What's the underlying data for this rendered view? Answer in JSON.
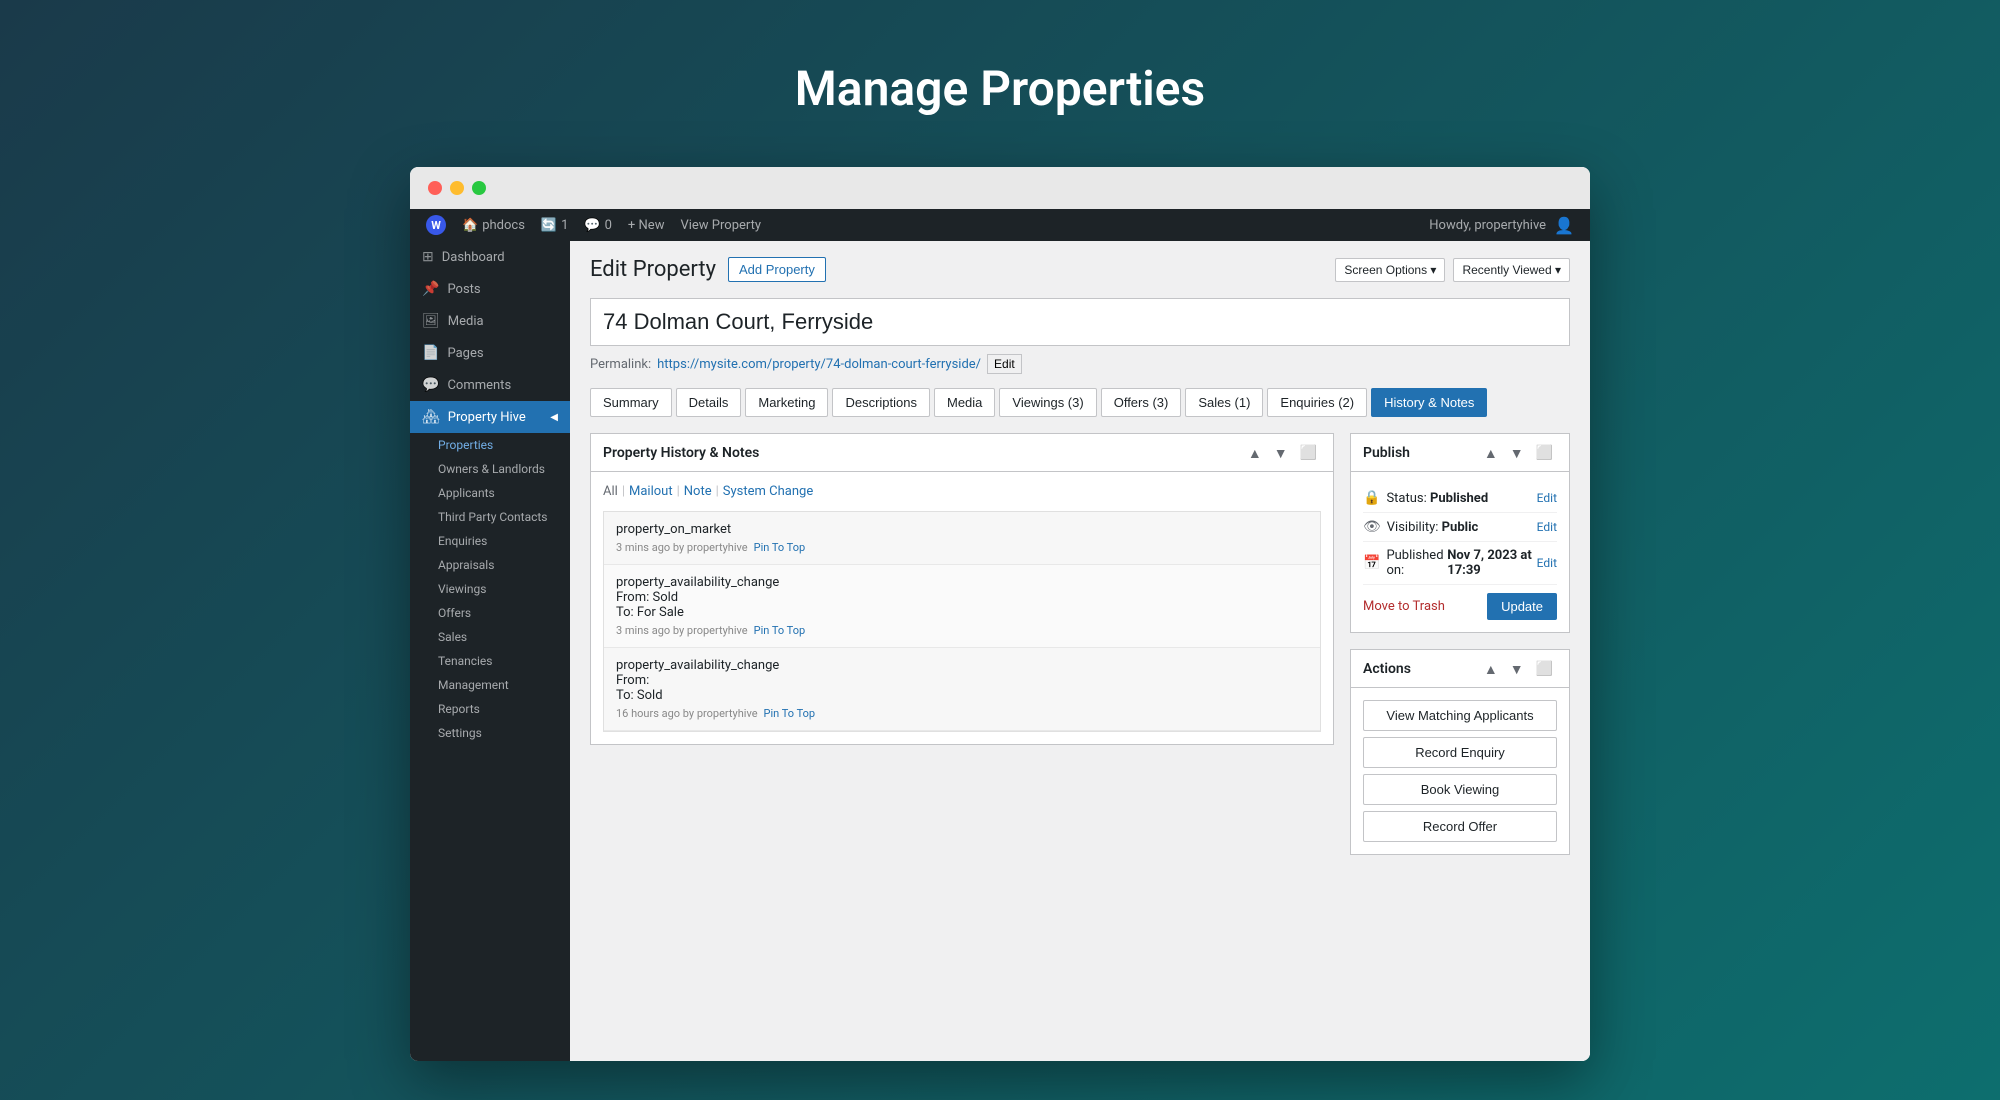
{
  "page": {
    "title": "Manage Properties"
  },
  "admin_bar": {
    "wp_label": "W",
    "site": "phdocs",
    "updates": "1",
    "comments": "0",
    "new_label": "+ New",
    "view_label": "View Property",
    "howdy": "Howdy, propertyhive"
  },
  "sidebar": {
    "dashboard": "Dashboard",
    "posts": "Posts",
    "media": "Media",
    "pages": "Pages",
    "comments": "Comments",
    "property_hive": "Property Hive",
    "properties": "Properties",
    "owners_landlords": "Owners & Landlords",
    "applicants": "Applicants",
    "third_party_contacts": "Third Party Contacts",
    "enquiries": "Enquiries",
    "appraisals": "Appraisals",
    "viewings": "Viewings",
    "offers": "Offers",
    "sales": "Sales",
    "tenancies": "Tenancies",
    "management": "Management",
    "reports": "Reports",
    "settings": "Settings"
  },
  "top_right": {
    "screen_options": "Screen Options ▾",
    "recently_viewed": "Recently Viewed ▾"
  },
  "content": {
    "heading": "Edit Property",
    "add_property_btn": "Add Property",
    "property_title": "74 Dolman Court, Ferryside",
    "permalink_label": "Permalink:",
    "permalink_url": "https://mysite.com/property/74-dolman-court-ferryside/",
    "permalink_edit": "Edit"
  },
  "tabs": [
    {
      "label": "Summary",
      "active": false
    },
    {
      "label": "Details",
      "active": false
    },
    {
      "label": "Marketing",
      "active": false
    },
    {
      "label": "Descriptions",
      "active": false
    },
    {
      "label": "Media",
      "active": false
    },
    {
      "label": "Viewings (3)",
      "active": false
    },
    {
      "label": "Offers (3)",
      "active": false
    },
    {
      "label": "Sales (1)",
      "active": false
    },
    {
      "label": "Enquiries (2)",
      "active": false
    },
    {
      "label": "History & Notes",
      "active": true
    }
  ],
  "history": {
    "box_title": "Property History & Notes",
    "filters": {
      "all": "All",
      "mailout": "Mailout",
      "note": "Note",
      "system_change": "System Change"
    },
    "entries": [
      {
        "text": "property_on_market",
        "meta": "3 mins ago by propertyhive",
        "pin": "Pin To Top"
      },
      {
        "text": "property_availability_change\nFrom: Sold\nTo: For Sale",
        "meta": "3 mins ago by propertyhive",
        "pin": "Pin To Top"
      },
      {
        "text": "property_availability_change\nFrom:\nTo: Sold",
        "meta": "16 hours ago by propertyhive",
        "pin": "Pin To Top"
      }
    ]
  },
  "publish": {
    "box_title": "Publish",
    "status_label": "Status:",
    "status_value": "Published",
    "status_edit": "Edit",
    "visibility_label": "Visibility:",
    "visibility_value": "Public",
    "visibility_edit": "Edit",
    "published_label": "Published on:",
    "published_value": "Nov 7, 2023 at 17:39",
    "published_edit": "Edit",
    "move_to_trash": "Move to Trash",
    "update_btn": "Update"
  },
  "actions": {
    "box_title": "Actions",
    "view_matching": "View Matching Applicants",
    "record_enquiry": "Record Enquiry",
    "book_viewing": "Book Viewing",
    "record_offer": "Record Offer"
  }
}
